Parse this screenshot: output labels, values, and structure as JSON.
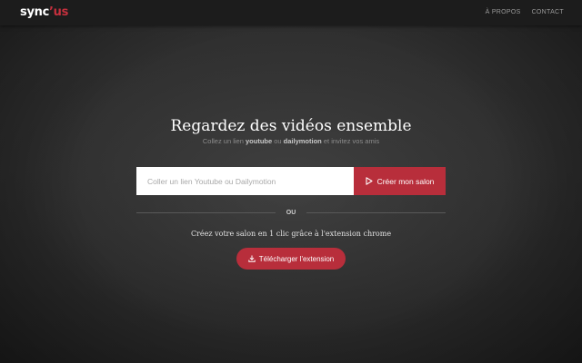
{
  "header": {
    "logo": {
      "main": "sync",
      "accent": "’us"
    },
    "nav": [
      "À PROPOS",
      "CONTACT"
    ]
  },
  "hero": {
    "title": "Regardez des vidéos ensemble",
    "subtitle": {
      "part1": "Collez un lien ",
      "youtube": "youtube",
      "part2": " ou ",
      "dailymotion": "dailymotion",
      "part3": " et invitez vos amis"
    }
  },
  "form": {
    "input_value": "",
    "input_placeholder": "Coller un lien Youtube ou Dailymotion",
    "create_label": "Créer mon salon"
  },
  "separator": {
    "label": "OU"
  },
  "extension": {
    "text": "Créez votre salon en 1 clic grâce à l'extension chrome",
    "download_label": "Télécharger l'extension"
  },
  "icons": {
    "play": "play-icon",
    "download": "download-icon"
  },
  "colors": {
    "accent": "#b82e3b",
    "logo_accent": "#c6303e",
    "topbar": "#1c1c1c",
    "background": "#2d2d2d"
  }
}
